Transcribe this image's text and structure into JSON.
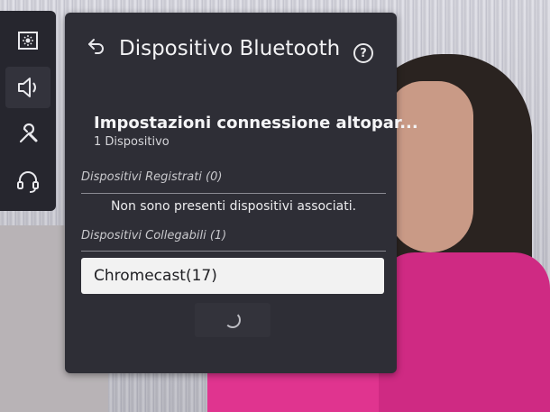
{
  "panel": {
    "title": "Dispositivo Bluetooth",
    "help_glyph": "?"
  },
  "section": {
    "title": "Impostazioni connessione altopar...",
    "subtitle": "1 Dispositivo"
  },
  "registered": {
    "label": "Dispositivi Registrati (0)",
    "empty_message": "Non sono presenti dispositivi associati."
  },
  "connectable": {
    "label": "Dispositivi Collegabili (1)",
    "devices": [
      {
        "name": "Chromecast(17)"
      }
    ]
  },
  "rail": {
    "items": [
      {
        "icon": "picture-settings-icon"
      },
      {
        "icon": "speaker-icon",
        "active": true
      },
      {
        "icon": "wrench-icon"
      },
      {
        "icon": "headset-icon"
      }
    ]
  },
  "colors": {
    "panel_bg": "#2e2e36",
    "rail_bg": "#26262e",
    "selected_item_bg": "#f2f2f2"
  }
}
